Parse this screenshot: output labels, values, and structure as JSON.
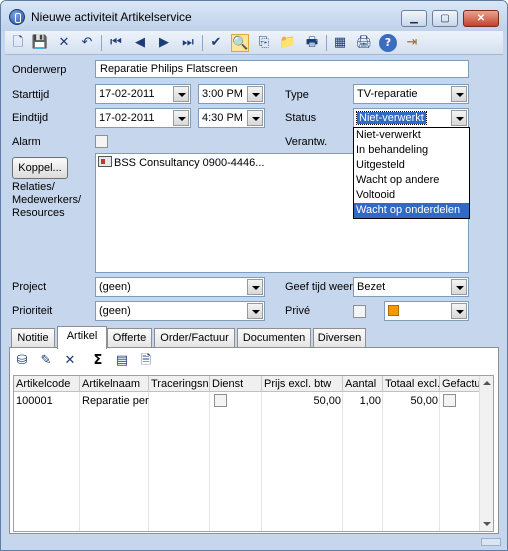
{
  "window": {
    "title": "Nieuwe activiteit Artikelservice",
    "controls": {
      "minimize": "▁",
      "maximize": "▢",
      "close": "✕"
    }
  },
  "toolbar": {
    "icons": [
      "new-icon",
      "save-icon",
      "delete-icon",
      "undo-icon",
      "first-record-icon",
      "previous-record-icon",
      "next-record-icon",
      "last-record-icon",
      "check-icon",
      "preview-icon",
      "copy-icon",
      "folder-icon",
      "print-preview-icon",
      "properties-icon",
      "print-icon",
      "help-icon",
      "exit-icon"
    ],
    "glyphs": [
      "🗋",
      "💾",
      "✕",
      "↶",
      "⏮",
      "◀",
      "▶",
      "⏭",
      "✔",
      "🔍",
      "⎘",
      "📁",
      "🖶",
      "▦",
      "🖨",
      "?",
      "⇥"
    ]
  },
  "form": {
    "onderwerp_label": "Onderwerp",
    "onderwerp_value": "Reparatie Philips Flatscreen",
    "starttijd_label": "Starttijd",
    "start_date": "17-02-2011",
    "start_time": "3:00 PM",
    "eindtijd_label": "Eindtijd",
    "end_date": "17-02-2011",
    "end_time": "4:30 PM",
    "type_label": "Type",
    "type_value": "TV-reparatie",
    "status_label": "Status",
    "status_value": "Niet-verwerkt",
    "alarm_label": "Alarm",
    "verantw_label": "Verantw.",
    "koppel_button": "Koppel...",
    "relaties_label": "Relaties/",
    "medewerkers_label": "Medewerkers/",
    "resources_label": "Resources",
    "relation_item": "BSS Consultancy 0900-4446...",
    "project_label": "Project",
    "project_value": "(geen)",
    "geef_tijd_label": "Geef tijd weer",
    "geef_tijd_value": "Bezet",
    "prioriteit_label": "Prioriteit",
    "prioriteit_value": "(geen)",
    "prive_label": "Privé",
    "color_accent": "#f39a00"
  },
  "status_dropdown": {
    "options": [
      "Niet-verwerkt",
      "In behandeling",
      "Uitgesteld",
      "Wacht op andere",
      "Voltooid",
      "Wacht op onderdelen"
    ],
    "highlighted": "Wacht op onderdelen"
  },
  "tabs": [
    "Notitie",
    "Artikel",
    "Offerte",
    "Order/Factuur",
    "Documenten",
    "Diversen"
  ],
  "active_tab": "Artikel",
  "panel_toolbar": {
    "icons": [
      "add-article-icon",
      "edit-article-icon",
      "delete-article-icon",
      "sum-icon",
      "stock-icon",
      "document-icon"
    ],
    "glyphs": [
      "⛁",
      "✎",
      "✕",
      "Σ",
      "▤",
      "🗎"
    ]
  },
  "grid": {
    "columns": [
      "Artikelcode",
      "Artikelnaam",
      "Traceringsnu",
      "Dienst",
      "Prijs excl. btw",
      "Aantal",
      "Totaal excl.",
      "Gefactu"
    ],
    "rows": [
      {
        "artikelcode": "100001",
        "artikelnaam": "Reparatie per",
        "traceringsnummer": "",
        "dienst": false,
        "prijs": "50,00",
        "aantal": "1,00",
        "totaal": "50,00",
        "gefactureerd": false
      }
    ]
  }
}
